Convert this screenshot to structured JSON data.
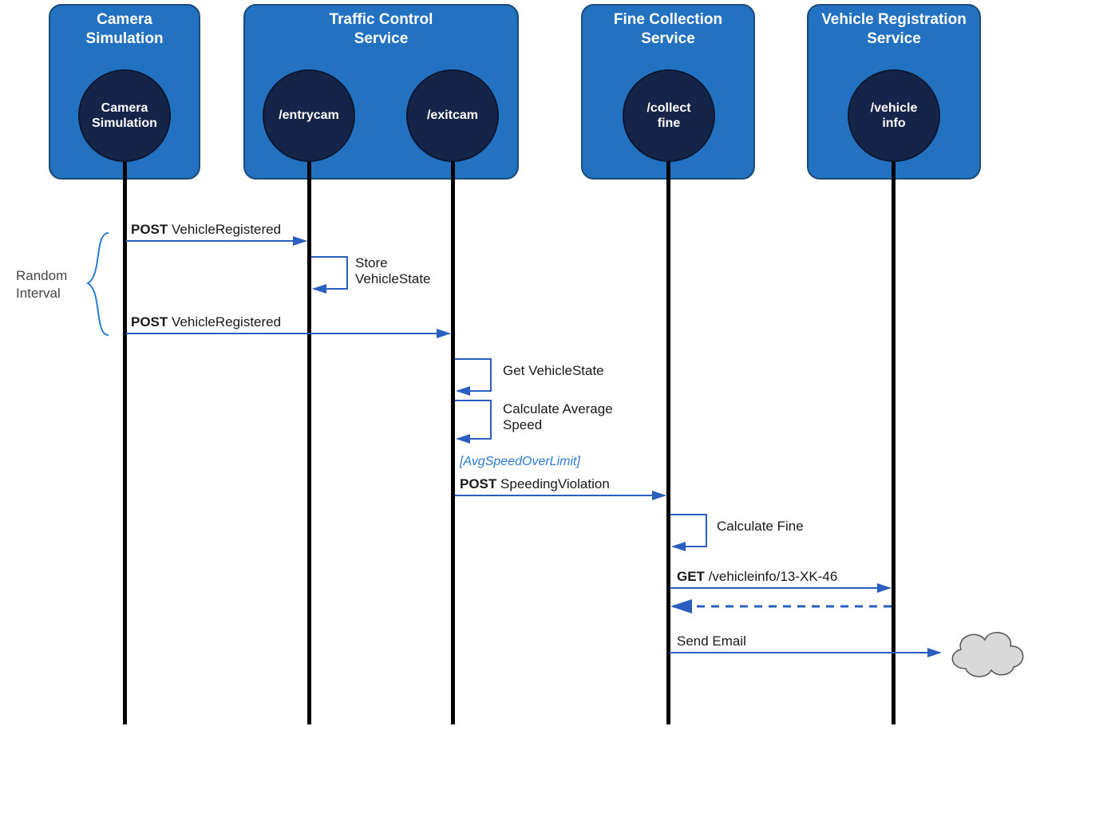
{
  "services": {
    "camera_sim": {
      "title": "Camera\nSimulation",
      "endpoint": "Camera\nSimulation"
    },
    "traffic_control": {
      "title": "Traffic Control\nService",
      "endpoints": {
        "entry": "/entrycam",
        "exit": "/exitcam"
      }
    },
    "fine_collection": {
      "title": "Fine Collection\nService",
      "endpoint": "/collect\nfine"
    },
    "vehicle_reg": {
      "title": "Vehicle Registration\nService",
      "endpoint": "/vehicle\ninfo"
    }
  },
  "side_note": "Random\nInterval",
  "messages": {
    "post_vehicle_registered_1": {
      "verb": "POST",
      "body": "VehicleRegistered"
    },
    "store_vehicle_state": "Store\nVehicleState",
    "post_vehicle_registered_2": {
      "verb": "POST",
      "body": "VehicleRegistered"
    },
    "get_vehicle_state": "Get VehicleState",
    "calc_avg_speed": "Calculate Average\nSpeed",
    "condition_avg_speed": "[AvgSpeedOverLimit]",
    "post_speeding_violation": {
      "verb": "POST",
      "body": "SpeedingViolation"
    },
    "calculate_fine": "Calculate Fine",
    "get_vehicle_info": {
      "verb": "GET",
      "body": "/vehicleinfo/13-XK-46"
    },
    "send_email": "Send Email"
  }
}
